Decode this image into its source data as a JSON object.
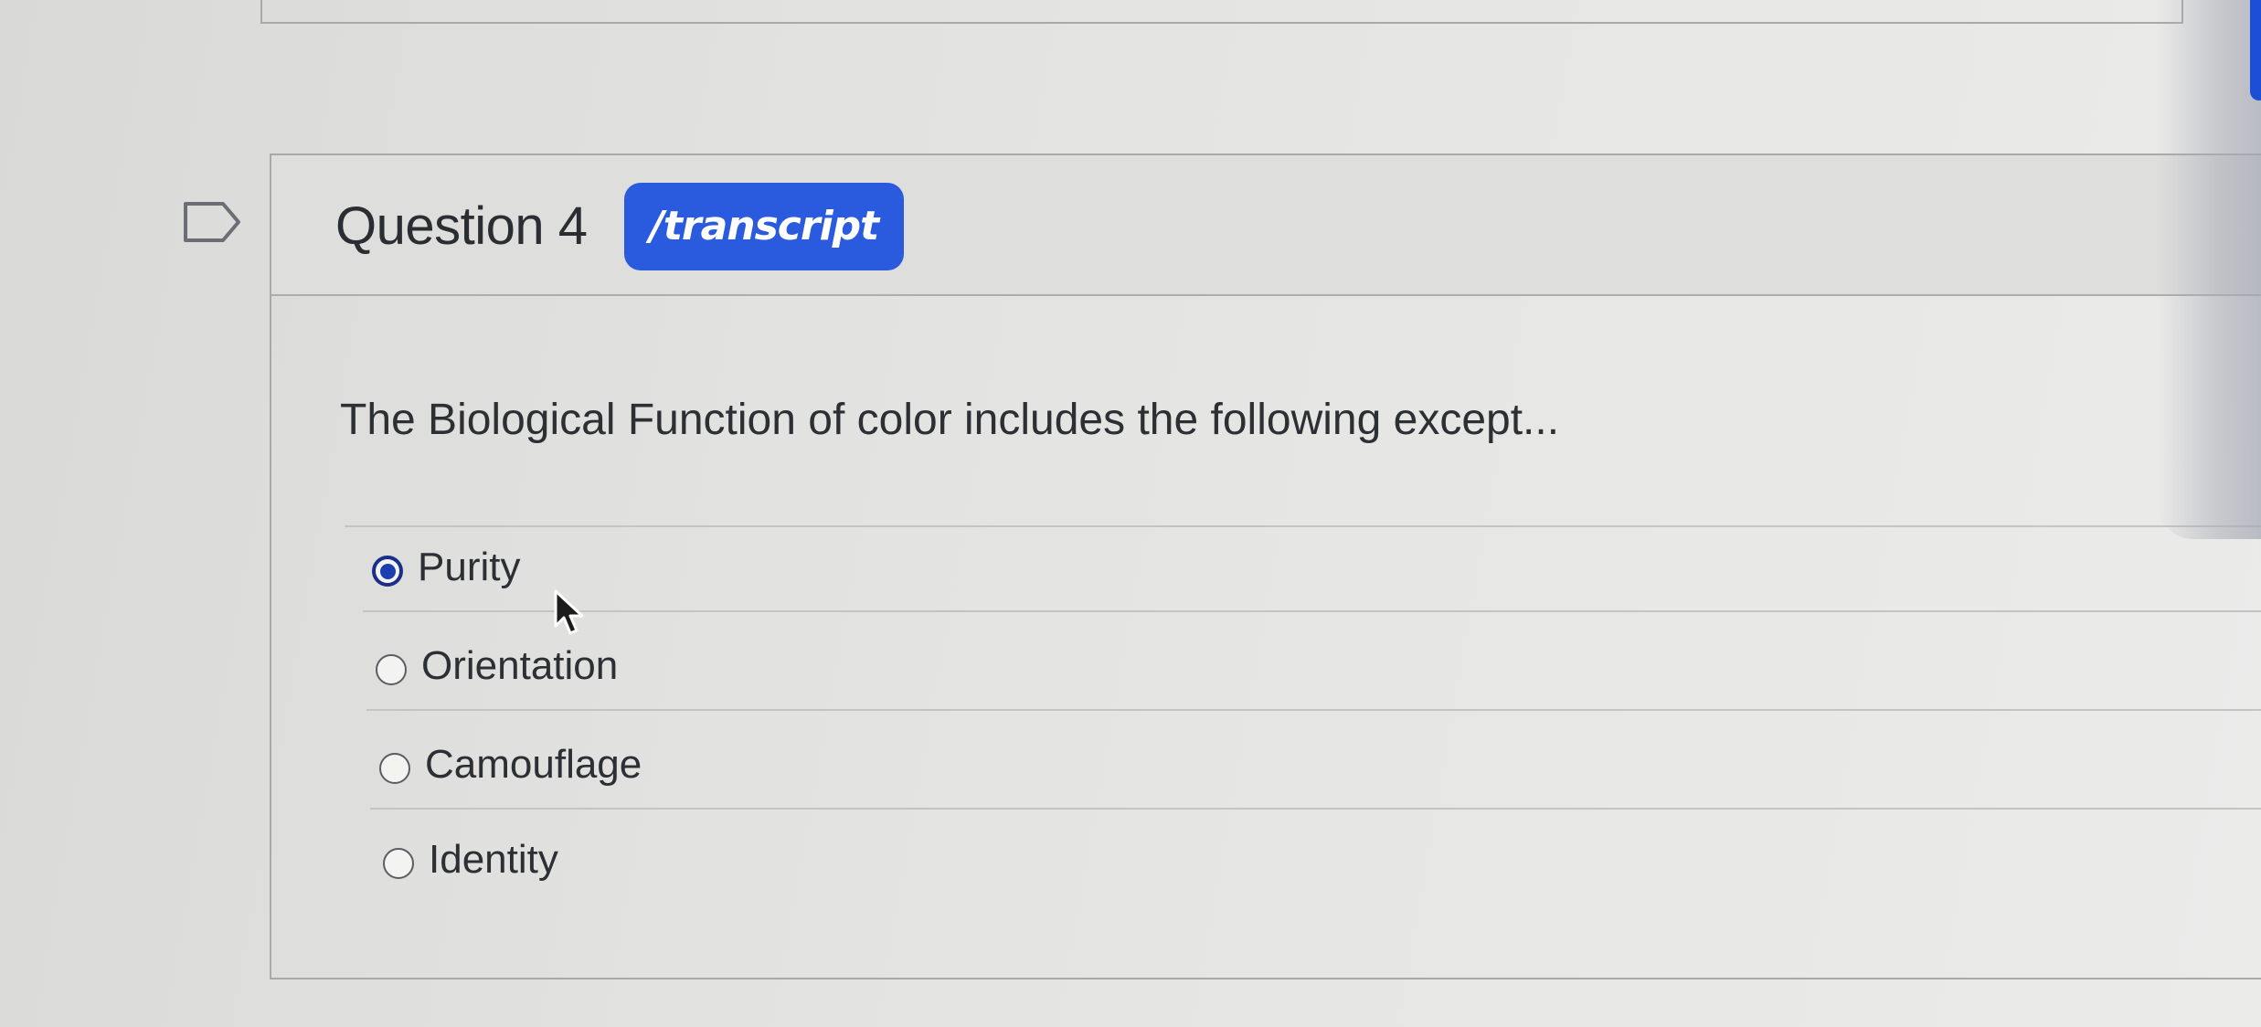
{
  "question": {
    "title": "Question 4",
    "badge_label": "/transcript",
    "prompt": "The Biological Function of color includes the following except..."
  },
  "answers": [
    {
      "label": "Purity",
      "selected": true
    },
    {
      "label": "Orientation",
      "selected": false
    },
    {
      "label": "Camouflage",
      "selected": false
    },
    {
      "label": "Identity",
      "selected": false
    }
  ],
  "colors": {
    "badge": "#2a5bde",
    "selected_radio": "#1b3fb0"
  },
  "icons": {
    "flag": "flag-outline-icon",
    "cursor": "mouse-pointer-icon"
  }
}
